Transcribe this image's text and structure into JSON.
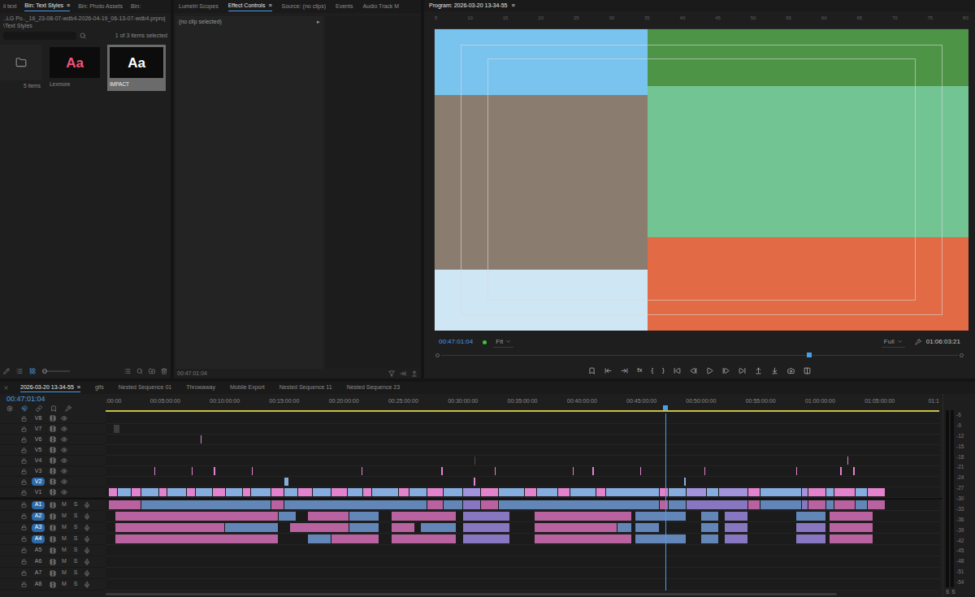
{
  "bin_panel": {
    "tabs": [
      {
        "label": "il text",
        "selected": false
      },
      {
        "label": "Bin: Text Styles",
        "selected": true,
        "menu": "≡"
      },
      {
        "label": "Bin: Photo Assets",
        "selected": false
      },
      {
        "label": "Bin:",
        "selected": false
      }
    ],
    "path": "..LG Po.._16_23-08-07-wdb4-2026-04-19_06-13-07-wdb4.prproj\\Text Styles",
    "selection": "1 of 3 items selected",
    "items": [
      {
        "kind": "folder",
        "caption": "5 items",
        "selected": false
      },
      {
        "kind": "style",
        "preview": "Aa",
        "caption": "Lexmore",
        "color": "#f0527f",
        "selected": false
      },
      {
        "kind": "style",
        "preview": "Aa",
        "caption": "IMPACT",
        "color": "#ffffff",
        "selected": true
      }
    ]
  },
  "effect_panel": {
    "tabs": [
      {
        "label": "Lumetri Scopes",
        "selected": false
      },
      {
        "label": "Effect Controls",
        "selected": true,
        "menu": "≡"
      },
      {
        "label": "Source: (no clips)",
        "selected": false
      },
      {
        "label": "Events",
        "selected": false
      },
      {
        "label": "Audio Track M",
        "selected": false
      }
    ],
    "empty_label": "(no clip selected)",
    "expand": "▸",
    "timecode": "00:47:01:04"
  },
  "program": {
    "tab": "Program: 2026-03-20 13-34-55",
    "menu": "≡",
    "ruler": [
      "5",
      "10",
      "15",
      "20",
      "25",
      "30",
      "35",
      "40",
      "45",
      "50",
      "55",
      "60",
      "65",
      "70",
      "75",
      "80"
    ],
    "timecode": "00:47:01:04",
    "zoom": "Fit",
    "quality": "Full",
    "duration": "01:06:03:21",
    "playback_position": 0.712,
    "transport": [
      {
        "kind": "icon"
      },
      {
        "kind": "icon"
      },
      {
        "kind": "icon"
      },
      {
        "kind": "text",
        "label": "fx"
      },
      {
        "kind": "text",
        "label": "{"
      },
      {
        "kind": "text",
        "label": "}"
      },
      {
        "kind": "icon"
      },
      {
        "kind": "icon"
      },
      {
        "kind": "icon"
      },
      {
        "kind": "icon"
      },
      {
        "kind": "icon"
      },
      {
        "kind": "icon"
      },
      {
        "kind": "icon"
      },
      {
        "kind": "icon"
      },
      {
        "kind": "icon"
      }
    ]
  },
  "timeline": {
    "tabs": [
      {
        "label": "2026-03-20 13-34-55",
        "selected": true,
        "menu": "≡"
      },
      {
        "label": "gifs",
        "selected": false
      },
      {
        "label": "Nested Sequence 01",
        "selected": false
      },
      {
        "label": "Throwaway",
        "selected": false
      },
      {
        "label": "Mobile Export",
        "selected": false
      },
      {
        "label": "Nested Sequence 11",
        "selected": false
      },
      {
        "label": "Nested Sequence 23",
        "selected": false
      }
    ],
    "timecode": "00:47:01:04",
    "ruler": [
      ":00:00",
      "00:05:00:00",
      "00:10:00:00",
      "00:15:00:00",
      "00:20:00:00",
      "00:25:00:00",
      "00:30:00:00",
      "00:35:00:00",
      "00:40:00:00",
      "00:45:00:00",
      "00:50:00:00",
      "00:55:00:00",
      "01:00:00:00",
      "01:05:00:00",
      "01:1"
    ],
    "playhead_minutes": 47.02,
    "mute_label": "M",
    "solo_label": "S",
    "video_tracks": [
      {
        "label": "V8",
        "targeted": false,
        "clips": []
      },
      {
        "label": "V7",
        "targeted": false,
        "clips": [
          {
            "start": 0.7,
            "end": 1.2,
            "color": "#3c3c3c"
          }
        ]
      },
      {
        "label": "V6",
        "targeted": false,
        "clips": [
          {
            "start": 8.0,
            "end": 8.1,
            "color": "#e383cd"
          }
        ]
      },
      {
        "label": "V5",
        "targeted": false,
        "clips": []
      },
      {
        "label": "V4",
        "targeted": false,
        "clips": [
          {
            "start": 3.6,
            "end": 3.7,
            "color": "#4a4a4a"
          },
          {
            "start": 19.5,
            "end": 19.6,
            "color": "#4a4a4a"
          },
          {
            "start": 31.0,
            "end": 31.1,
            "color": "#4a4a4a"
          },
          {
            "start": 62.3,
            "end": 62.4,
            "color": "#e383cd"
          }
        ]
      },
      {
        "label": "V3",
        "targeted": false,
        "clips": [
          {
            "start": 4.1,
            "end": 4.25,
            "color": "#e383cd"
          },
          {
            "start": 7.2,
            "end": 7.35,
            "color": "#e383cd"
          },
          {
            "start": 9.1,
            "end": 9.25,
            "color": "#e383cd"
          },
          {
            "start": 12.3,
            "end": 12.45,
            "color": "#e383cd"
          },
          {
            "start": 21.5,
            "end": 21.65,
            "color": "#e383cd"
          },
          {
            "start": 28.2,
            "end": 28.35,
            "color": "#e383cd"
          },
          {
            "start": 32.7,
            "end": 32.85,
            "color": "#e383cd"
          },
          {
            "start": 39.2,
            "end": 39.35,
            "color": "#e383cd"
          },
          {
            "start": 40.9,
            "end": 41.05,
            "color": "#e383cd"
          },
          {
            "start": 44.9,
            "end": 45.05,
            "color": "#e383cd"
          },
          {
            "start": 50.3,
            "end": 50.45,
            "color": "#e383cd"
          },
          {
            "start": 58.0,
            "end": 58.15,
            "color": "#e383cd"
          },
          {
            "start": 61.7,
            "end": 61.85,
            "color": "#e383cd"
          },
          {
            "start": 62.8,
            "end": 62.95,
            "color": "#e383cd"
          }
        ]
      },
      {
        "label": "V2",
        "targeted": true,
        "clips": [
          {
            "start": 15.0,
            "end": 15.4,
            "color": "#86addf"
          },
          {
            "start": 30.9,
            "end": 31.1,
            "color": "#e383cd"
          },
          {
            "start": 48.6,
            "end": 48.8,
            "color": "#86addf"
          }
        ]
      },
      {
        "label": "V1",
        "targeted": false,
        "clips": [
          {
            "start": 0.3,
            "end": 1.0,
            "color": "#e383cd"
          },
          {
            "start": 1.0,
            "end": 2.2,
            "color": "#86addf"
          },
          {
            "start": 2.2,
            "end": 3.0,
            "color": "#e383cd"
          },
          {
            "start": 3.0,
            "end": 4.5,
            "color": "#86addf"
          },
          {
            "start": 4.5,
            "end": 5.2,
            "color": "#e383cd"
          },
          {
            "start": 5.2,
            "end": 6.8,
            "color": "#86addf"
          },
          {
            "start": 6.8,
            "end": 7.6,
            "color": "#e383cd"
          },
          {
            "start": 7.6,
            "end": 9.0,
            "color": "#86addf"
          },
          {
            "start": 9.0,
            "end": 10.1,
            "color": "#e383cd"
          },
          {
            "start": 10.1,
            "end": 11.5,
            "color": "#86addf"
          },
          {
            "start": 11.5,
            "end": 12.2,
            "color": "#e383cd"
          },
          {
            "start": 12.2,
            "end": 13.9,
            "color": "#86addf"
          },
          {
            "start": 13.9,
            "end": 15.0,
            "color": "#e383cd"
          },
          {
            "start": 15.0,
            "end": 16.2,
            "color": "#86addf"
          },
          {
            "start": 16.2,
            "end": 17.4,
            "color": "#e383cd"
          },
          {
            "start": 17.4,
            "end": 19.0,
            "color": "#86addf"
          },
          {
            "start": 19.0,
            "end": 20.3,
            "color": "#e383cd"
          },
          {
            "start": 20.3,
            "end": 21.6,
            "color": "#86addf"
          },
          {
            "start": 21.6,
            "end": 22.4,
            "color": "#e383cd"
          },
          {
            "start": 22.4,
            "end": 24.6,
            "color": "#86addf"
          },
          {
            "start": 24.6,
            "end": 25.5,
            "color": "#e383cd"
          },
          {
            "start": 25.5,
            "end": 27.0,
            "color": "#86addf"
          },
          {
            "start": 27.0,
            "end": 28.4,
            "color": "#e383cd"
          },
          {
            "start": 28.4,
            "end": 30.0,
            "color": "#86addf"
          },
          {
            "start": 30.0,
            "end": 31.5,
            "color": "#a193dc"
          },
          {
            "start": 31.5,
            "end": 33.0,
            "color": "#e383cd"
          },
          {
            "start": 33.0,
            "end": 35.2,
            "color": "#86addf"
          },
          {
            "start": 35.2,
            "end": 36.2,
            "color": "#e383cd"
          },
          {
            "start": 36.2,
            "end": 38.0,
            "color": "#86addf"
          },
          {
            "start": 38.0,
            "end": 39.0,
            "color": "#e383cd"
          },
          {
            "start": 39.0,
            "end": 41.2,
            "color": "#86addf"
          },
          {
            "start": 41.2,
            "end": 42.0,
            "color": "#e383cd"
          },
          {
            "start": 42.0,
            "end": 46.5,
            "color": "#86addf"
          },
          {
            "start": 46.5,
            "end": 47.3,
            "color": "#e383cd"
          },
          {
            "start": 47.3,
            "end": 48.8,
            "color": "#86addf"
          },
          {
            "start": 48.8,
            "end": 50.5,
            "color": "#a193dc"
          },
          {
            "start": 50.5,
            "end": 51.5,
            "color": "#86addf"
          },
          {
            "start": 51.5,
            "end": 54.0,
            "color": "#a193dc"
          },
          {
            "start": 54.0,
            "end": 55.0,
            "color": "#e383cd"
          },
          {
            "start": 55.0,
            "end": 58.5,
            "color": "#86addf"
          },
          {
            "start": 58.5,
            "end": 59.0,
            "color": "#a193dc"
          },
          {
            "start": 59.0,
            "end": 60.5,
            "color": "#e383cd"
          },
          {
            "start": 60.5,
            "end": 61.2,
            "color": "#86addf"
          },
          {
            "start": 61.2,
            "end": 63.0,
            "color": "#e383cd"
          },
          {
            "start": 63.0,
            "end": 64.0,
            "color": "#86addf"
          },
          {
            "start": 64.0,
            "end": 65.5,
            "color": "#e383cd"
          }
        ]
      }
    ],
    "audio_tracks": [
      {
        "label": "A1",
        "targeted": true,
        "clips": [
          {
            "start": 0.3,
            "end": 3.0,
            "color": "#b8629f"
          },
          {
            "start": 3.0,
            "end": 13.9,
            "color": "#6286b8"
          },
          {
            "start": 13.9,
            "end": 15.0,
            "color": "#b8629f"
          },
          {
            "start": 15.0,
            "end": 27.0,
            "color": "#6286b8"
          },
          {
            "start": 27.0,
            "end": 28.4,
            "color": "#b8629f"
          },
          {
            "start": 28.4,
            "end": 30.0,
            "color": "#6286b8"
          },
          {
            "start": 30.0,
            "end": 31.5,
            "color": "#8677c0"
          },
          {
            "start": 31.5,
            "end": 33.0,
            "color": "#b8629f"
          },
          {
            "start": 33.0,
            "end": 46.5,
            "color": "#6286b8"
          },
          {
            "start": 46.5,
            "end": 47.3,
            "color": "#b8629f"
          },
          {
            "start": 47.3,
            "end": 48.8,
            "color": "#6286b8"
          },
          {
            "start": 48.8,
            "end": 54.0,
            "color": "#8677c0"
          },
          {
            "start": 54.0,
            "end": 55.0,
            "color": "#b8629f"
          },
          {
            "start": 55.0,
            "end": 58.5,
            "color": "#6286b8"
          },
          {
            "start": 58.5,
            "end": 59.0,
            "color": "#8677c0"
          },
          {
            "start": 59.0,
            "end": 60.5,
            "color": "#b8629f"
          },
          {
            "start": 60.5,
            "end": 61.2,
            "color": "#6286b8"
          },
          {
            "start": 61.2,
            "end": 63.0,
            "color": "#b8629f"
          },
          {
            "start": 63.0,
            "end": 64.0,
            "color": "#6286b8"
          },
          {
            "start": 64.0,
            "end": 65.5,
            "color": "#b8629f"
          }
        ]
      },
      {
        "label": "A2",
        "targeted": true,
        "clips": [
          {
            "start": 0.8,
            "end": 14.5,
            "color": "#b8629f"
          },
          {
            "start": 14.5,
            "end": 16.0,
            "color": "#6286b8"
          },
          {
            "start": 17.0,
            "end": 20.5,
            "color": "#b8629f"
          },
          {
            "start": 20.5,
            "end": 23.0,
            "color": "#6286b8"
          },
          {
            "start": 24.0,
            "end": 29.5,
            "color": "#b8629f"
          },
          {
            "start": 30.0,
            "end": 34.0,
            "color": "#8677c0"
          },
          {
            "start": 36.0,
            "end": 44.2,
            "color": "#b8629f"
          },
          {
            "start": 44.5,
            "end": 48.8,
            "color": "#6286b8"
          },
          {
            "start": 50.0,
            "end": 51.5,
            "color": "#6286b8"
          },
          {
            "start": 52.0,
            "end": 54.0,
            "color": "#8677c0"
          },
          {
            "start": 58.0,
            "end": 60.5,
            "color": "#6286b8"
          },
          {
            "start": 60.8,
            "end": 64.5,
            "color": "#b8629f"
          }
        ]
      },
      {
        "label": "A3",
        "targeted": true,
        "clips": [
          {
            "start": 0.8,
            "end": 10.0,
            "color": "#b8629f"
          },
          {
            "start": 10.0,
            "end": 14.5,
            "color": "#6286b8"
          },
          {
            "start": 15.5,
            "end": 20.5,
            "color": "#b8629f"
          },
          {
            "start": 20.5,
            "end": 23.0,
            "color": "#6286b8"
          },
          {
            "start": 24.0,
            "end": 26.0,
            "color": "#b8629f"
          },
          {
            "start": 26.5,
            "end": 29.5,
            "color": "#6286b8"
          },
          {
            "start": 30.0,
            "end": 34.0,
            "color": "#8677c0"
          },
          {
            "start": 36.0,
            "end": 43.0,
            "color": "#b8629f"
          },
          {
            "start": 43.0,
            "end": 44.2,
            "color": "#6286b8"
          },
          {
            "start": 44.5,
            "end": 46.5,
            "color": "#6286b8"
          },
          {
            "start": 50.0,
            "end": 51.5,
            "color": "#6286b8"
          },
          {
            "start": 52.0,
            "end": 54.0,
            "color": "#8677c0"
          },
          {
            "start": 58.0,
            "end": 60.5,
            "color": "#8677c0"
          },
          {
            "start": 60.8,
            "end": 64.5,
            "color": "#b8629f"
          }
        ]
      },
      {
        "label": "A4",
        "targeted": true,
        "clips": [
          {
            "start": 0.8,
            "end": 14.5,
            "color": "#b8629f"
          },
          {
            "start": 17.0,
            "end": 19.0,
            "color": "#6286b8"
          },
          {
            "start": 19.0,
            "end": 23.0,
            "color": "#b8629f"
          },
          {
            "start": 24.0,
            "end": 29.5,
            "color": "#b8629f"
          },
          {
            "start": 30.0,
            "end": 34.0,
            "color": "#8677c0"
          },
          {
            "start": 36.0,
            "end": 44.2,
            "color": "#b8629f"
          },
          {
            "start": 44.5,
            "end": 48.8,
            "color": "#6286b8"
          },
          {
            "start": 50.0,
            "end": 51.5,
            "color": "#6286b8"
          },
          {
            "start": 52.0,
            "end": 54.0,
            "color": "#8677c0"
          },
          {
            "start": 58.0,
            "end": 60.5,
            "color": "#8677c0"
          },
          {
            "start": 60.8,
            "end": 64.5,
            "color": "#b8629f"
          }
        ]
      },
      {
        "label": "A5",
        "targeted": false,
        "clips": []
      },
      {
        "label": "A6",
        "targeted": false,
        "clips": []
      },
      {
        "label": "A7",
        "targeted": false,
        "clips": []
      },
      {
        "label": "A8",
        "targeted": false,
        "clips": []
      }
    ]
  },
  "meter": {
    "scale": [
      "-6",
      "-9",
      "-12",
      "-15",
      "-18",
      "-21",
      "-24",
      "-27",
      "-30",
      "-33",
      "-36",
      "-39",
      "-42",
      "-45",
      "-48",
      "-51",
      "-54"
    ],
    "solo": [
      "S",
      "S"
    ]
  }
}
